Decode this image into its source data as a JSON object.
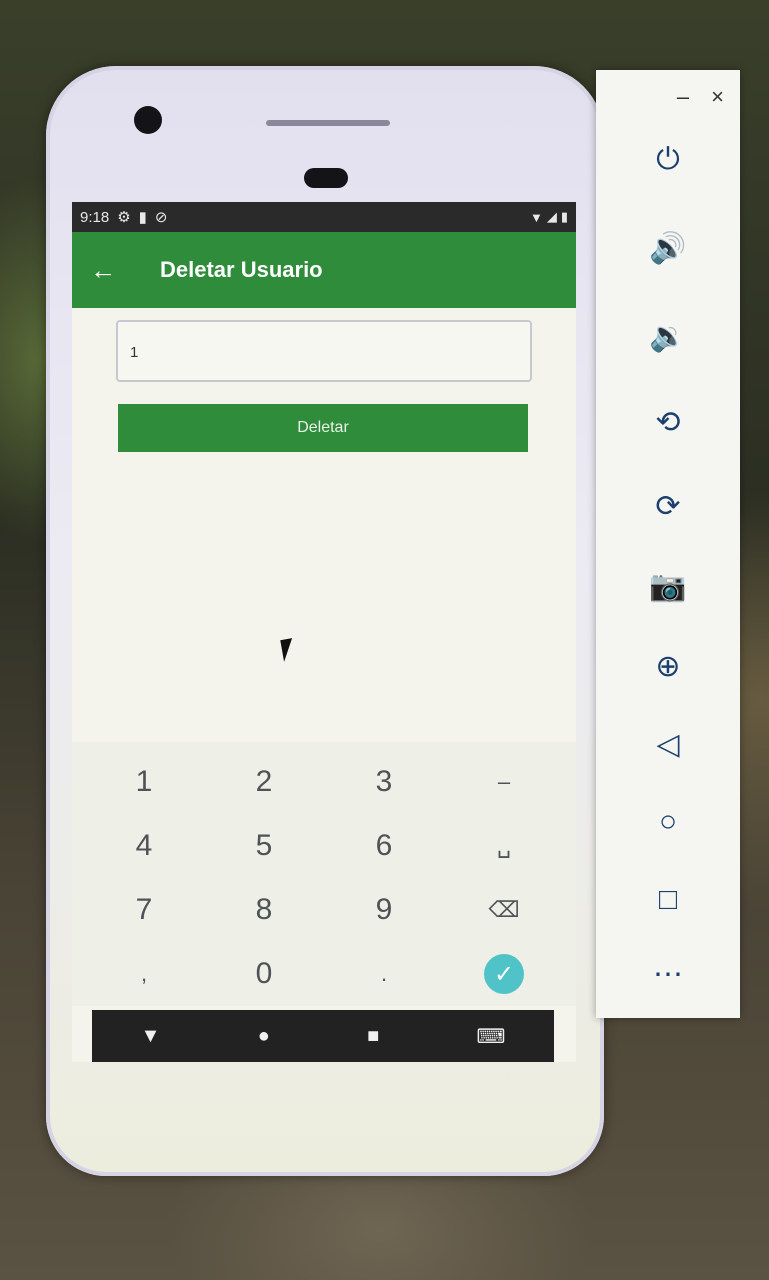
{
  "status_bar": {
    "time": "9:18",
    "left_icons": [
      "settings-icon",
      "sd-card-icon",
      "no-disturb-icon"
    ],
    "right_icons": [
      "wifi-icon",
      "signal-icon",
      "battery-icon"
    ]
  },
  "app_bar": {
    "title": "Deletar Usuario"
  },
  "form": {
    "id_value": "1",
    "delete_button_label": "Deletar"
  },
  "keypad": {
    "keys": [
      "1",
      "2",
      "3",
      "–",
      "4",
      "5",
      "6",
      "␣",
      "7",
      "8",
      "9",
      "⌫",
      ",",
      "0",
      ".",
      "✓"
    ]
  },
  "nav_bar": {
    "back": "▼",
    "home": "●",
    "recents": "■",
    "keyboard": "⌨"
  },
  "toolbar": {
    "minimize": "–",
    "close": "×",
    "tools": [
      {
        "name": "power-icon",
        "glyph": "⏻"
      },
      {
        "name": "volume-up-icon",
        "glyph": "🔊"
      },
      {
        "name": "volume-down-icon",
        "glyph": "🔉"
      },
      {
        "name": "rotate-left-icon",
        "glyph": "⟲"
      },
      {
        "name": "rotate-right-icon",
        "glyph": "⟳"
      },
      {
        "name": "camera-icon",
        "glyph": "📷"
      },
      {
        "name": "zoom-icon",
        "glyph": "⊕"
      },
      {
        "name": "back-icon",
        "glyph": "◁"
      },
      {
        "name": "home-icon",
        "glyph": "○"
      },
      {
        "name": "overview-icon",
        "glyph": "□"
      },
      {
        "name": "more-icon",
        "glyph": "⋯"
      }
    ]
  },
  "colors": {
    "app_bar": "#2e8c3a",
    "button": "#2e8c3a",
    "done_key": "#4fc3c8",
    "toolbar_icons": "#1c3f6e"
  }
}
